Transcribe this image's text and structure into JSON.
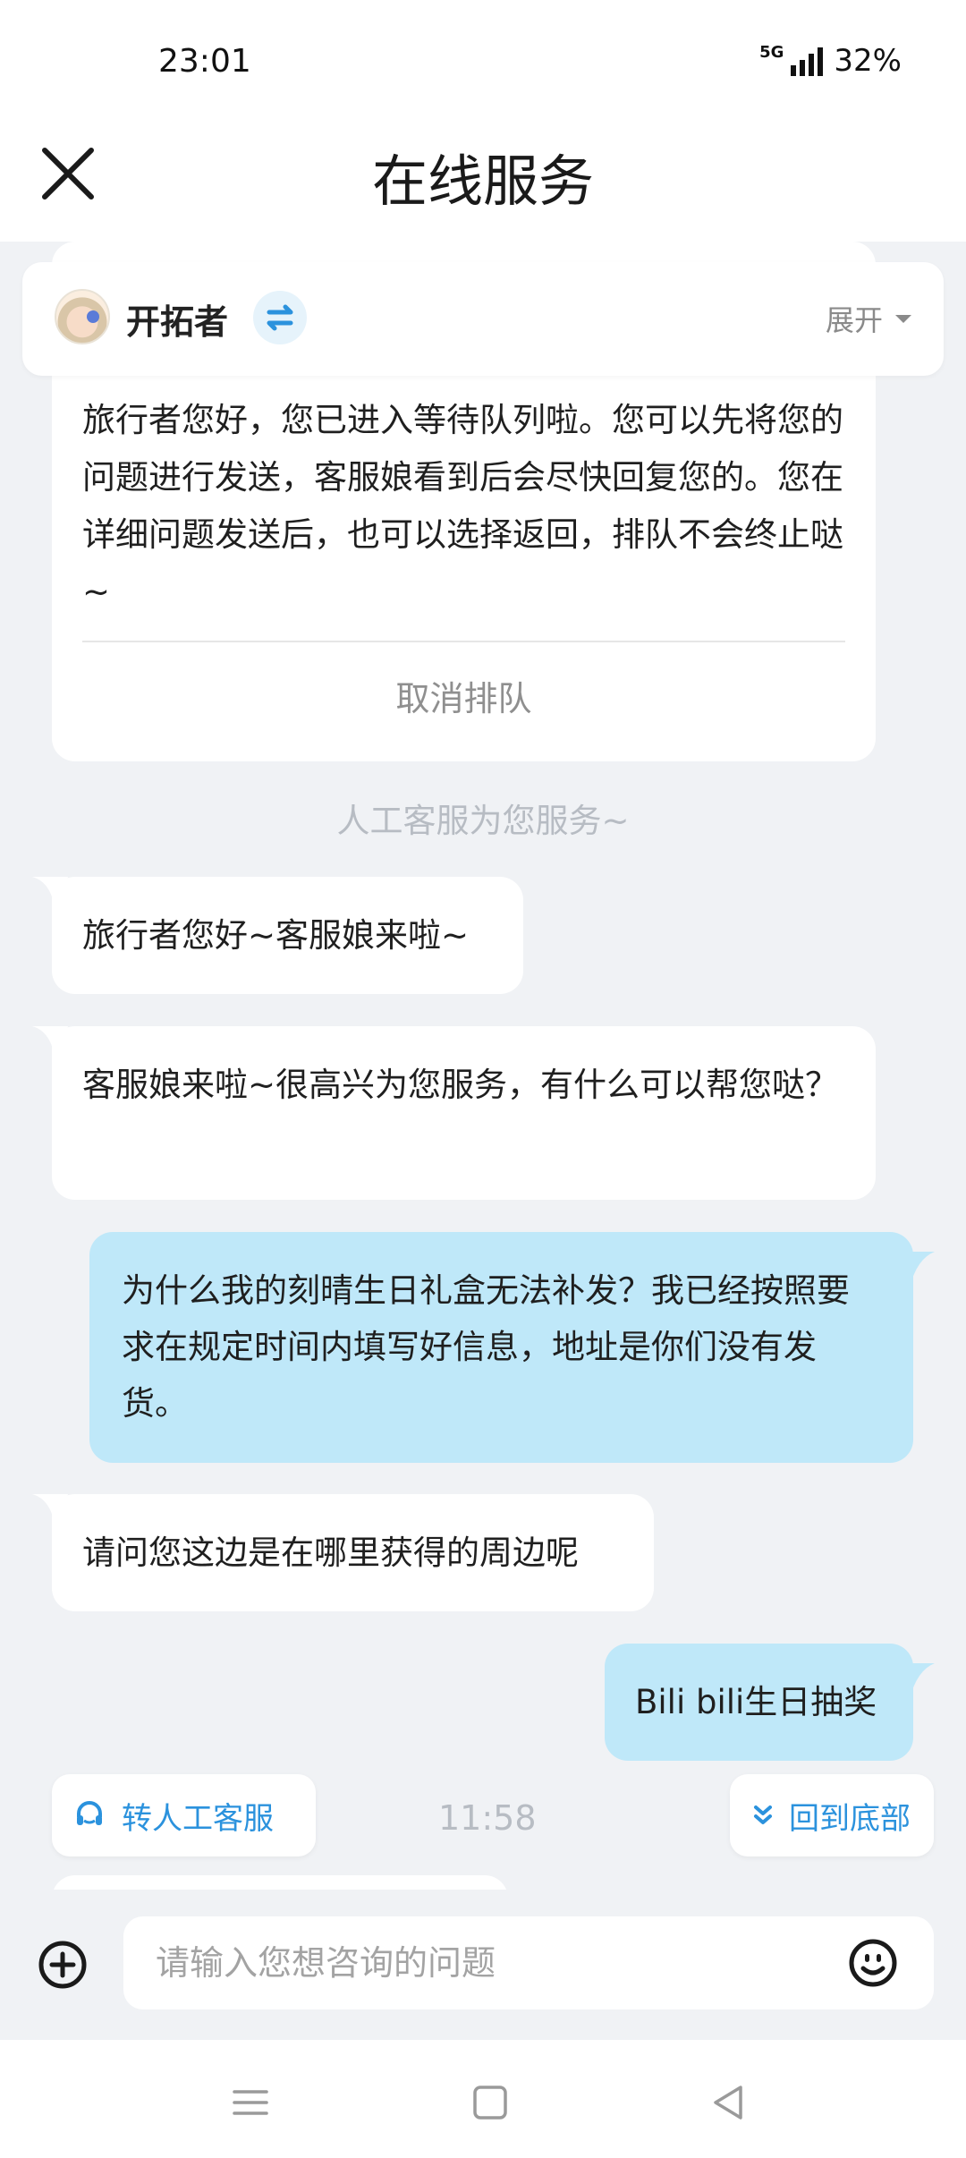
{
  "status_bar": {
    "time": "23:01",
    "network": "5G",
    "battery": "32%"
  },
  "header": {
    "title": "在线服务"
  },
  "agent": {
    "name": "开拓者",
    "expand_label": "展开"
  },
  "messages": {
    "queue_notice": "旅行者您好，您已进入等待队列啦。您可以先将您的问题进行发送，客服娘看到后会尽快回复您的。您在详细问题发送后，也可以选择返回，排队不会终止哒~",
    "cancel_queue": "取消排队",
    "system_note": "人工客服为您服务~",
    "m1": "旅行者您好~客服娘来啦~",
    "m2": "客服娘来啦~很高兴为您服务，有什么可以帮您哒？",
    "m3": "为什么我的刻晴生日礼盒无法补发？我已经按照要求在规定时间内填写好信息，地址是你们没有发货。",
    "m4": "请问您这边是在哪里获得的周边呢",
    "m5": "Bili bili生日抽奖",
    "timestamp": "11:58"
  },
  "actions": {
    "transfer_label": "转人工客服",
    "scroll_bottom_label": "回到底部"
  },
  "composer": {
    "placeholder": "请输入您想咨询的问题"
  },
  "colors": {
    "accent": "#2b92dd",
    "user_bubble": "#bfe8f9",
    "background": "#f0f2f5"
  },
  "icons": [
    "close-icon",
    "swap-icon",
    "chevron-down-icon",
    "headset-icon",
    "double-chevron-down-icon",
    "plus-circle-icon",
    "smiley-icon",
    "menu-icon",
    "home-square-icon",
    "back-triangle-icon"
  ]
}
